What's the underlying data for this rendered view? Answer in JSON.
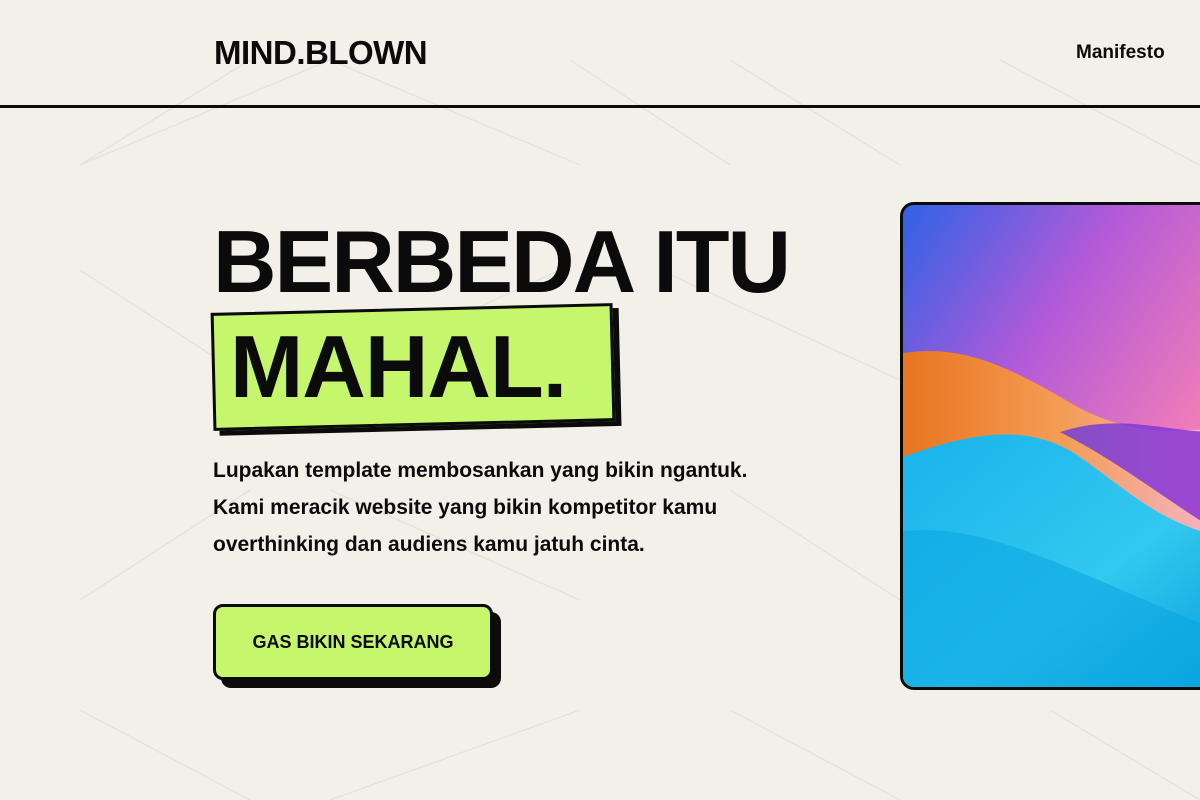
{
  "header": {
    "logo": "MIND.BLOWN",
    "nav": {
      "manifesto_label": "Manifesto"
    }
  },
  "hero": {
    "headline_line1": "BERBEDA ITU",
    "headline_highlight": "MAHAL.",
    "subtext_lines": [
      "Lupakan template membosankan yang bikin ngantuk.",
      "Kami meracik website yang bikin kompetitor kamu",
      "overthinking dan audiens kamu jatuh cinta."
    ],
    "cta_label": "GAS BIKIN SEKARANG"
  },
  "colors": {
    "background": "#f3f0ea",
    "ink": "#0b0b0b",
    "accent": "#c6f66b"
  },
  "hero_art": {
    "icon": "abstract-gradient-image"
  }
}
